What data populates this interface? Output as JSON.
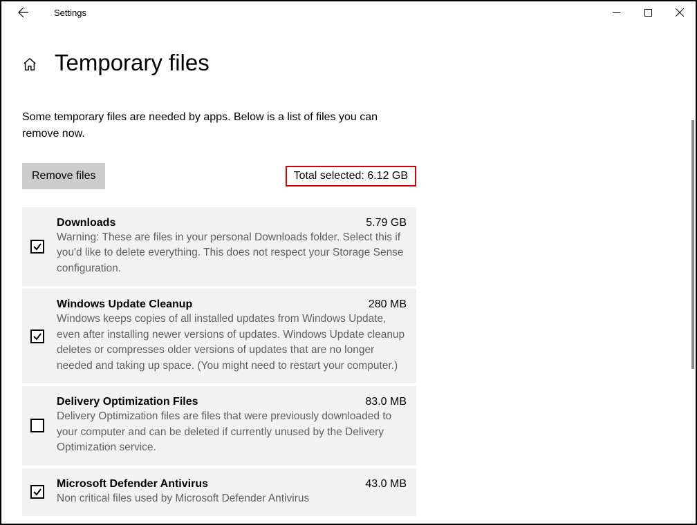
{
  "window": {
    "app_title": "Settings"
  },
  "page": {
    "title": "Temporary files",
    "intro": "Some temporary files are needed by apps. Below is a list of files you can remove now."
  },
  "actions": {
    "remove_label": "Remove files",
    "total_selected_label": "Total selected: 6.12 GB"
  },
  "items": [
    {
      "checked": true,
      "title": "Downloads",
      "size": "5.79 GB",
      "desc": "Warning: These are files in your personal Downloads folder. Select this if you'd like to delete everything. This does not respect your Storage Sense configuration."
    },
    {
      "checked": true,
      "title": "Windows Update Cleanup",
      "size": "280 MB",
      "desc": "Windows keeps copies of all installed updates from Windows Update, even after installing newer versions of updates. Windows Update cleanup deletes or compresses older versions of updates that are no longer needed and taking up space. (You might need to restart your computer.)"
    },
    {
      "checked": false,
      "title": "Delivery Optimization Files",
      "size": "83.0 MB",
      "desc": "Delivery Optimization files are files that were previously downloaded to your computer and can be deleted if currently unused by the Delivery Optimization service."
    },
    {
      "checked": true,
      "title": "Microsoft Defender Antivirus",
      "size": "43.0 MB",
      "desc": "Non critical files used by Microsoft Defender Antivirus"
    }
  ]
}
